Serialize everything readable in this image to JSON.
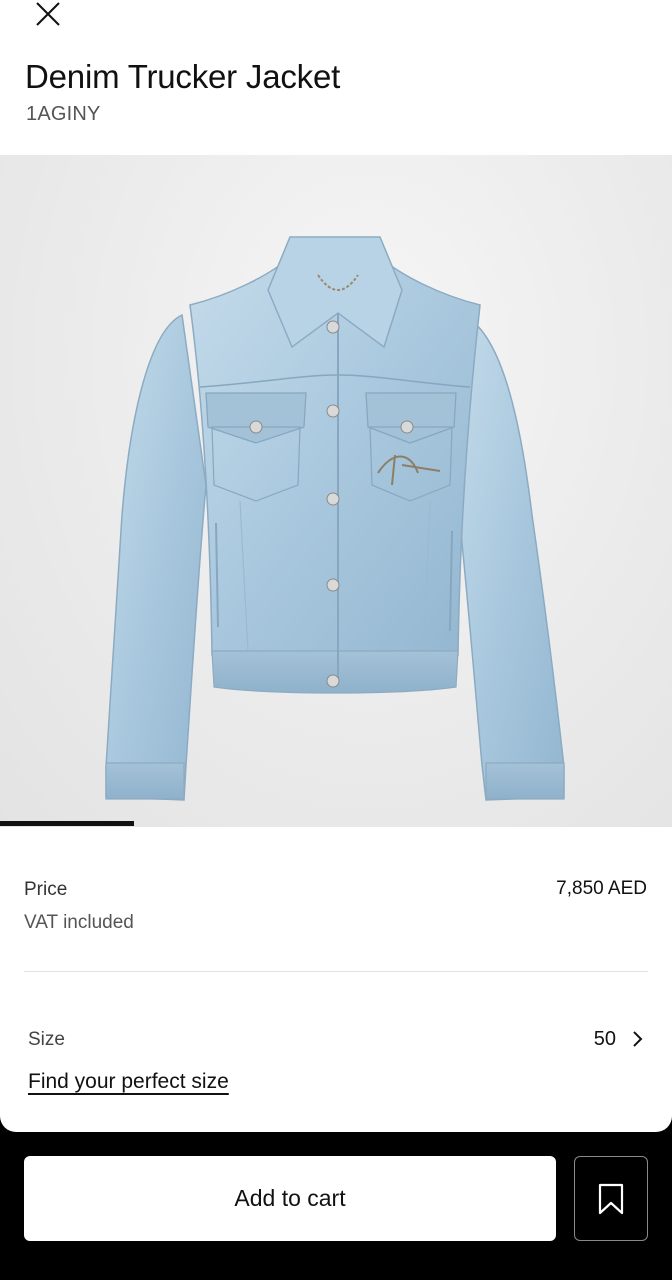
{
  "product": {
    "title": "Denim Trucker Jacket",
    "sku": "1AGINY"
  },
  "gallery": {
    "progress_fraction": 0.2,
    "image_subject": "light-wash denim trucker jacket"
  },
  "price": {
    "label": "Price",
    "vat_note": "VAT included",
    "value": "7,850 AED"
  },
  "size": {
    "label": "Size",
    "selected": "50",
    "guide_link": "Find your perfect size"
  },
  "actions": {
    "add_to_cart": "Add to cart"
  },
  "icons": {
    "close": "close-icon",
    "chevron": "chevron-right-icon",
    "wishlist": "bookmark-icon"
  },
  "colors": {
    "accent": "#111111",
    "bottom_bar": "#000000",
    "denim": "#a9c8de"
  }
}
